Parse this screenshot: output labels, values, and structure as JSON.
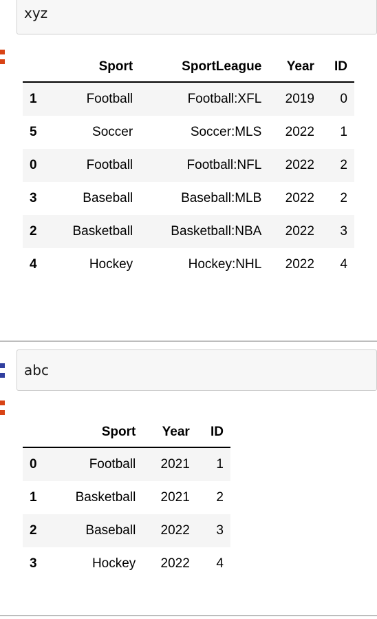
{
  "notebook": {
    "cells": [
      {
        "kind": "code-input-clipped",
        "code": "xyz",
        "clipped_line_above": true
      },
      {
        "kind": "output-dataframe",
        "prompt": "out-prompt",
        "table": {
          "index_header": "",
          "columns": [
            "Sport",
            "SportLeague",
            "Year",
            "ID"
          ],
          "index": [
            "1",
            "5",
            "0",
            "3",
            "2",
            "4"
          ],
          "rows": [
            [
              "Football",
              "Football:XFL",
              "2019",
              "0"
            ],
            [
              "Soccer",
              "Soccer:MLS",
              "2022",
              "1"
            ],
            [
              "Football",
              "Football:NFL",
              "2022",
              "2"
            ],
            [
              "Baseball",
              "Baseball:MLB",
              "2022",
              "2"
            ],
            [
              "Basketball",
              "Basketball:NBA",
              "2022",
              "3"
            ],
            [
              "Hockey",
              "Hockey:NHL",
              "2022",
              "4"
            ]
          ]
        }
      },
      {
        "kind": "code-input",
        "prompt": "in-prompt",
        "code": "abc"
      },
      {
        "kind": "output-dataframe",
        "prompt": "out-prompt",
        "table": {
          "index_header": "",
          "columns": [
            "Sport",
            "Year",
            "ID"
          ],
          "index": [
            "0",
            "1",
            "2",
            "3"
          ],
          "rows": [
            [
              "Football",
              "2021",
              "1"
            ],
            [
              "Basketball",
              "2021",
              "2"
            ],
            [
              "Baseball",
              "2022",
              "3"
            ],
            [
              "Hockey",
              "2022",
              "4"
            ]
          ]
        }
      }
    ]
  },
  "colors": {
    "in_prompt": "#303f9f",
    "out_prompt": "#d84315",
    "input_bg": "#f7f7f7",
    "input_border": "#cfcfcf",
    "row_stripe": "#f5f5f5",
    "separator": "#bdbdbd",
    "text": "#000000"
  }
}
